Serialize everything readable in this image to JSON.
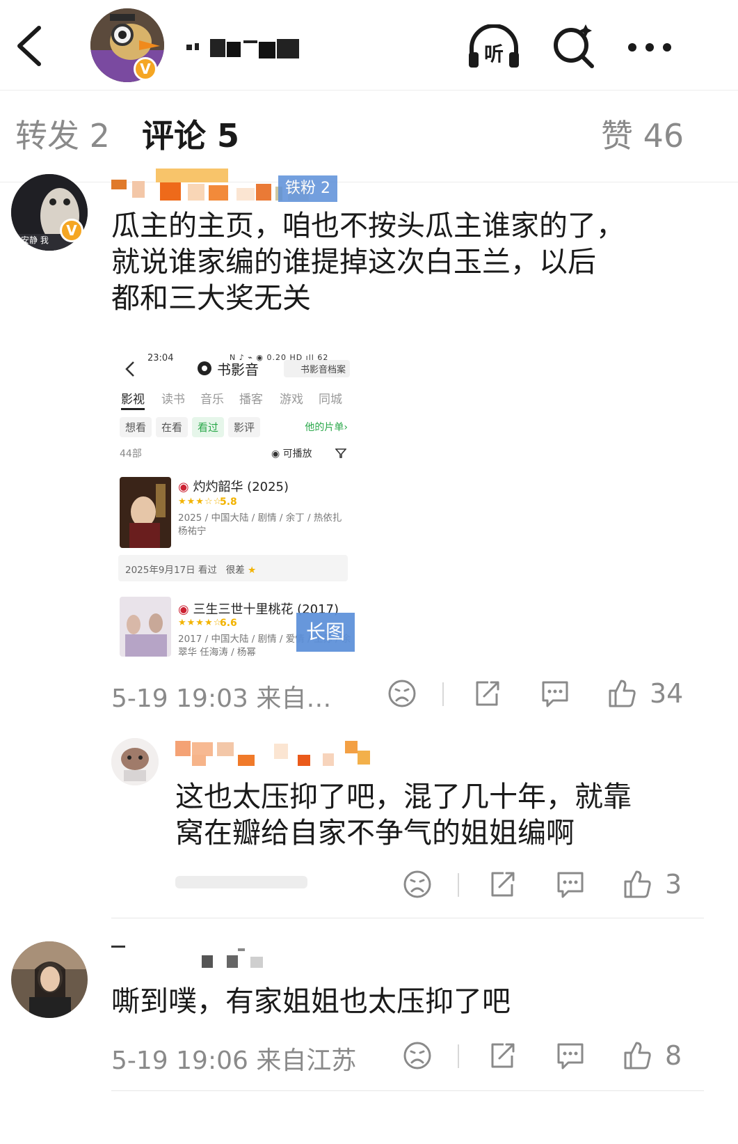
{
  "tabs": {
    "repost": "转发 2",
    "comments": "评论 5",
    "likes": "赞 46"
  },
  "comments": [
    {
      "fan_badge": "铁粉 2",
      "avatar_caption": "安静 我",
      "text_lines": [
        "瓜主的主页，咱也不按头瓜主谁家的了，",
        "就说谁家编的谁提掉这次白玉兰，以后",
        "都和三大奖无关"
      ],
      "time": "5-19 19:03 来自…",
      "likes": "34",
      "image_badge": "长图"
    },
    {
      "name_fragment": "我的",
      "text_lines": [
        "这也太压抑了吧，混了几十年，就靠",
        "窝在瓣给自家不争气的姐姐编啊"
      ],
      "likes": "3"
    },
    {
      "text_lines": [
        "嘶到噗，有家姐姐也太压抑了吧"
      ],
      "time": "5-19 19:06 来自江苏",
      "likes": "8"
    }
  ],
  "screenshot": {
    "time": "23:04",
    "status_icons": "N ♪ ⌁ ◉ 0.20 HD ıll 62",
    "title": "书影音",
    "archive": "书影音档案",
    "tabs": [
      "影视",
      "读书",
      "音乐",
      "播客",
      "游戏",
      "同城"
    ],
    "chips": [
      "想看",
      "在看",
      "看过",
      "影评"
    ],
    "list_link": "他的片单›",
    "count": "44部",
    "play_filter": "可播放",
    "movies": [
      {
        "title": "灼灼韶华 (2025)",
        "rating": "5.8",
        "stars_filled": 3,
        "info": "2025 / 中国大陆 / 剧情 / 余丁 / 热依扎 杨祐宁",
        "watched": "2025年9月17日 看过",
        "verdict": "很差"
      },
      {
        "title": "三生三世十里桃花 (2017)",
        "rating": "6.6",
        "stars_filled": 3.5,
        "info": "2017 / 中国大陆 / 剧情 / 爱情 / 王苏 / 余翠华 任海涛 / 杨幂"
      }
    ]
  },
  "colors": {
    "text": "#1a1a1a",
    "secondary": "#8a8a8a",
    "badge": "#f5a623",
    "fan_badge": "#5b8fd9",
    "green": "#2aa84a"
  }
}
